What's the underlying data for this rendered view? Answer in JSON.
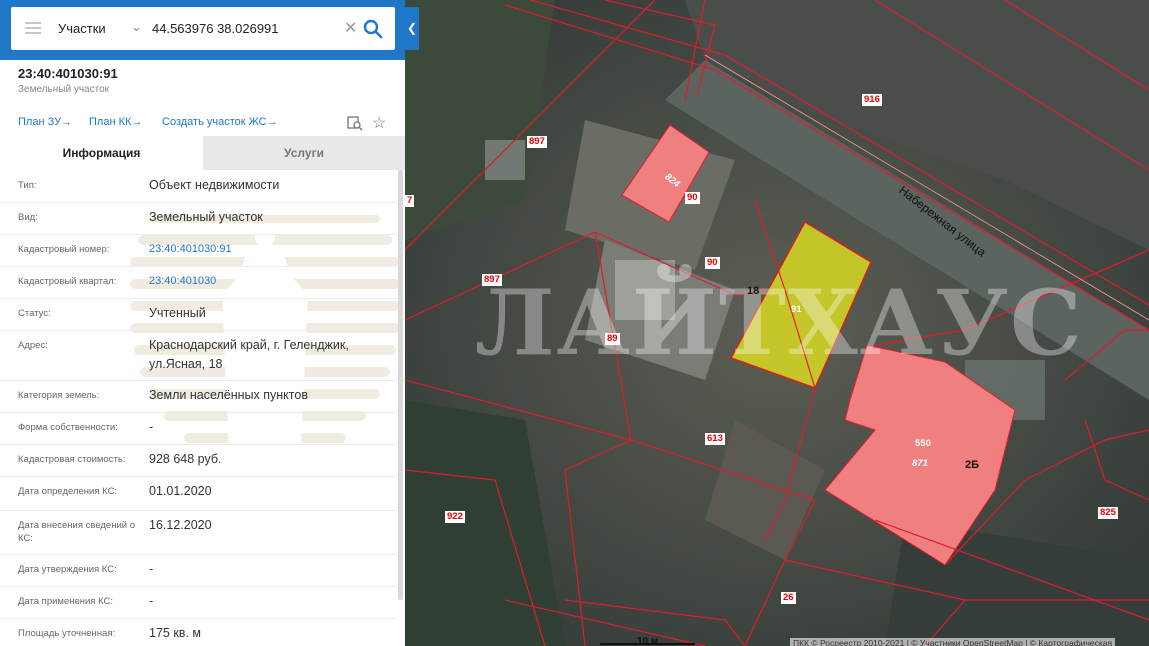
{
  "search": {
    "type": "Участки",
    "value": "44.563976 38.026991"
  },
  "parcel": {
    "id": "23:40:401030:91",
    "type": "Земельный участок"
  },
  "links": {
    "plan_zu": "План ЗУ",
    "plan_kk": "План КК",
    "create_zs": "Создать участок ЖС"
  },
  "tabs": {
    "info": "Информация",
    "services": "Услуги"
  },
  "info_rows": [
    {
      "label": "Тип:",
      "value": "Объект недвижимости"
    },
    {
      "label": "Вид:",
      "value": "Земельный участок"
    },
    {
      "label": "Кадастровый номер:",
      "value": "23:40:401030:91"
    },
    {
      "label": "Кадастровый квартал:",
      "value": "23:40:401030"
    },
    {
      "label": "Статус:",
      "value": "Учтенный"
    },
    {
      "label": "Адрес:",
      "value": "Краснодарский край, г. Геленджик, ул.Ясная, 18"
    },
    {
      "label": "Категория земель:",
      "value": "Земли населённых пунктов"
    },
    {
      "label": "Форма собственности:",
      "value": "-"
    },
    {
      "label": "Кадастровая стоимость:",
      "value": "928 648 руб."
    },
    {
      "label": "Дата определения КС:",
      "value": "01.01.2020"
    },
    {
      "label": "Дата внесения сведений о КС:",
      "value": "16.12.2020"
    },
    {
      "label": "Дата утверждения КС:",
      "value": "-"
    },
    {
      "label": "Дата применения КС:",
      "value": "-"
    },
    {
      "label": "Площадь уточненная:",
      "value": "175 кв. м"
    }
  ],
  "map": {
    "watermark": "ЛАЙТХАУС",
    "street": "Набережная улица",
    "scale": "10 м",
    "attribution": "ПКК © Росреестр 2010-2021 | © Участники OpenStreetMap | © Картографическая",
    "parcel_labels": {
      "l916": "916",
      "l897a": "897",
      "l897b": "897",
      "l824": "824",
      "l90a": "90",
      "l90b": "90",
      "l91": "91",
      "l89": "89",
      "l613": "613",
      "l550": "550",
      "l871": "871",
      "l922": "922",
      "l825": "825",
      "l26": "26",
      "l7": "7"
    },
    "house_numbers": {
      "n18": "18",
      "n2b": "2Б"
    },
    "colors": {
      "selected": "#e4e41f",
      "building": "#f08080",
      "boundary": "#e01c2a"
    }
  }
}
